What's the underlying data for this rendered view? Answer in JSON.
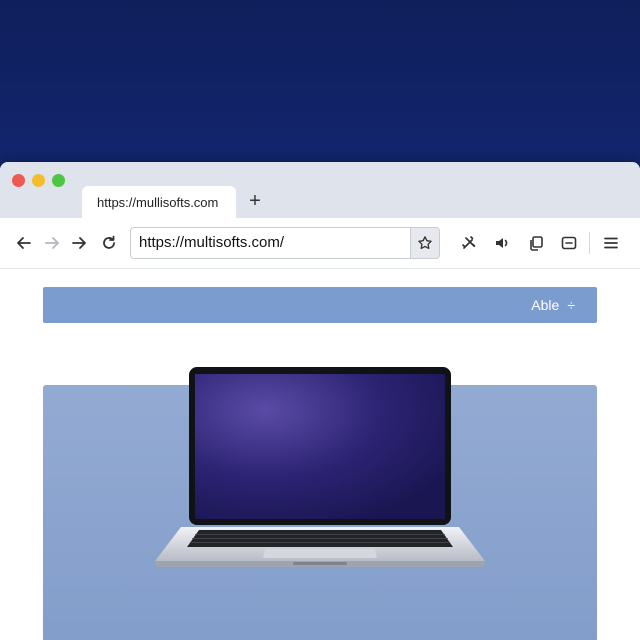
{
  "browser": {
    "tab": {
      "title": "https://mullisofts.com"
    },
    "new_tab_symbol": "+",
    "address_bar": {
      "url": "https://multisofts.com/"
    },
    "icons": [
      "back-icon",
      "forward-icon",
      "forward-alt-icon",
      "reload-icon",
      "bookmark-star-icon",
      "extensions-icon",
      "speaker-icon",
      "copy-icon",
      "sidebar-icon",
      "menu-icon"
    ]
  },
  "page": {
    "banner": {
      "action_label": "Able",
      "action_symbol": "÷"
    },
    "hero": {
      "device": "laptop",
      "screen_color": "#2a2070"
    }
  },
  "colors": {
    "background": "#15297a",
    "tabstrip": "#dfe3ec",
    "banner": "#7b9ccf",
    "hero": "#8aa4cf",
    "traffic_red": "#ee5a52",
    "traffic_yellow": "#f3bd2f",
    "traffic_green": "#4fc545"
  }
}
